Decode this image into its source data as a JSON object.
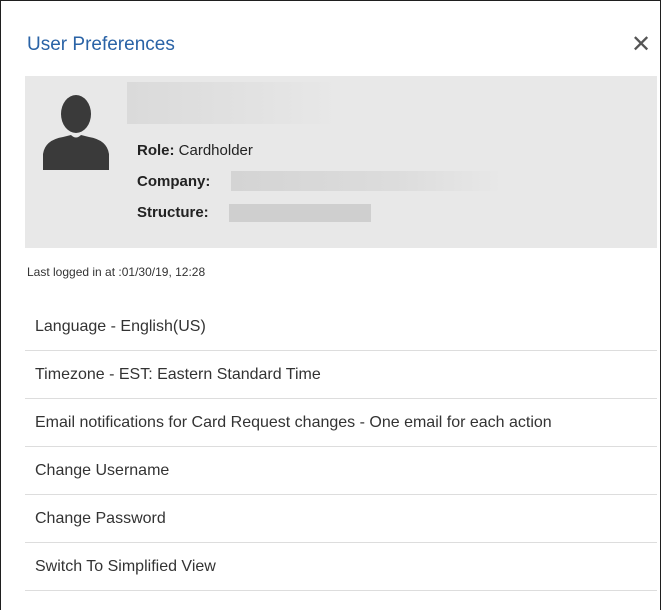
{
  "dialog": {
    "title": "User Preferences",
    "close_icon": "close-icon"
  },
  "profile": {
    "avatar_icon": "user-silhouette-icon",
    "role_label": "Role:",
    "role_value": "Cardholder",
    "company_label": "Company:",
    "structure_label": "Structure:"
  },
  "last_logged": "Last logged in at :01/30/19, 12:28",
  "menu": {
    "items": [
      "Language - English(US)",
      "Timezone - EST: Eastern Standard Time",
      "Email notifications for Card Request changes - One email for each action",
      "Change Username",
      "Change Password",
      "Switch To Simplified View"
    ]
  },
  "colors": {
    "title": "#2a63a6",
    "profile_bg": "#e8e8e8",
    "avatar": "#3a3a3a"
  }
}
